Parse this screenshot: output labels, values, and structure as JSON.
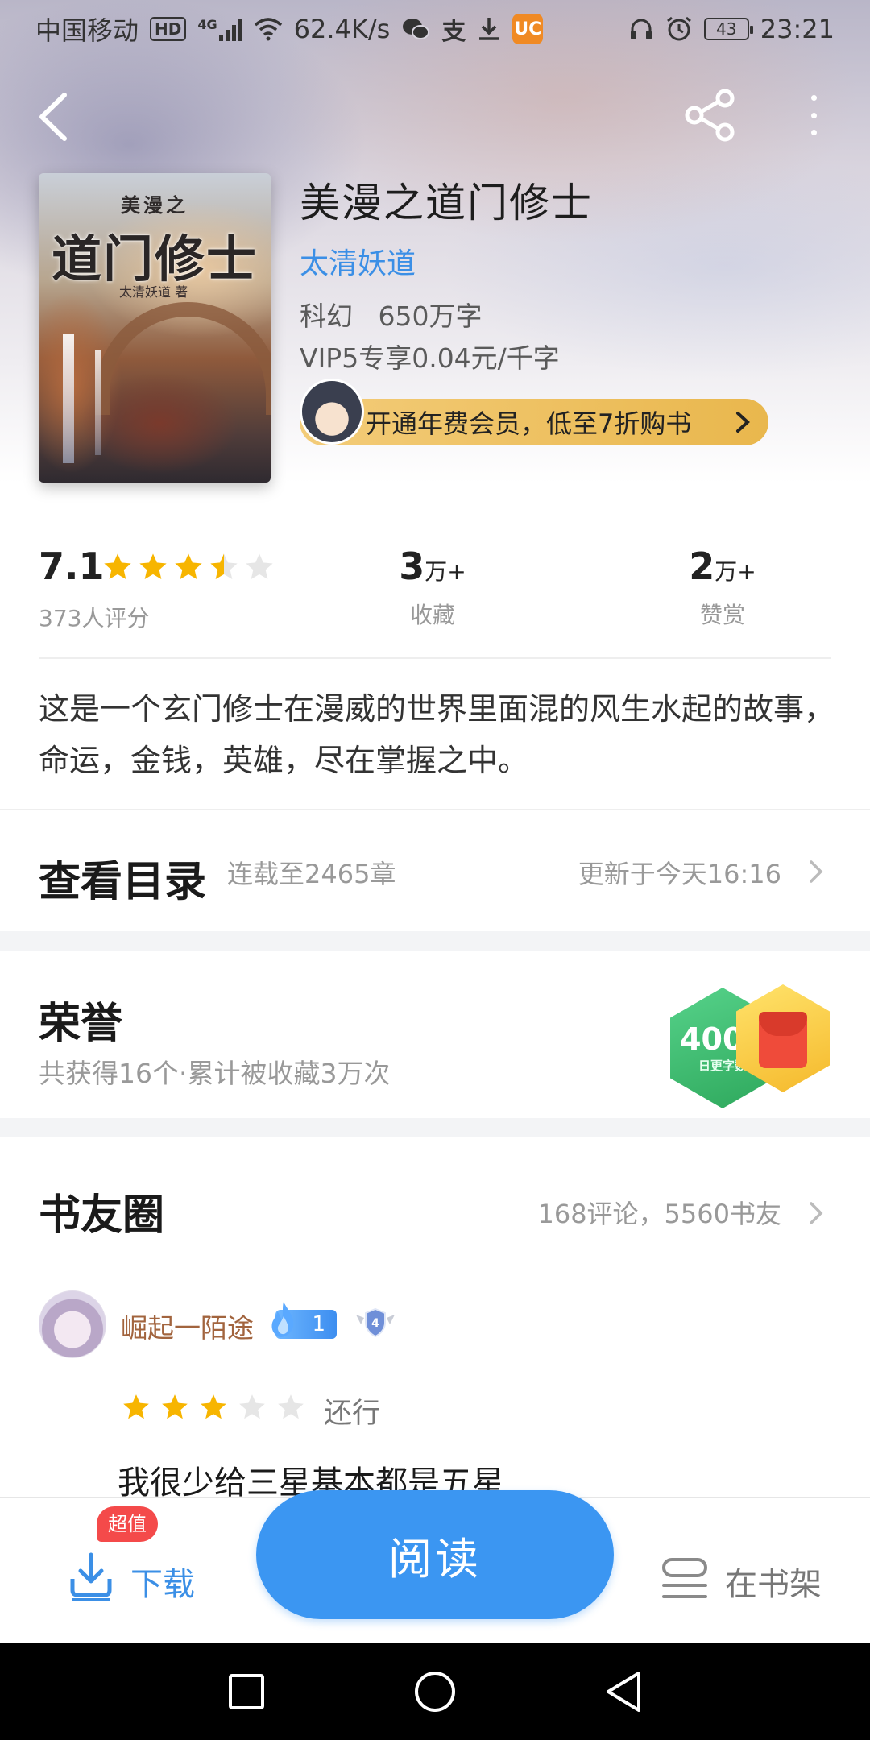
{
  "status_bar": {
    "carrier": "中国移动",
    "hd": "HD",
    "network": "4G",
    "speed": "62.4K/s",
    "battery": "43",
    "time": "23:21"
  },
  "book": {
    "cover_top": "美漫之",
    "cover_title": "道门修士",
    "cover_author": "太清妖道 著",
    "title": "美漫之道门修士",
    "author": "太清妖道",
    "meta": "科幻   650万字",
    "price": "VIP5专享0.04元/千字",
    "vip_banner": "开通年费会员，低至7折购书"
  },
  "stats": {
    "rating": "7.1",
    "rating_count": "373人评分",
    "stars": 3.5,
    "favorites_num": "3",
    "favorites_unit": "万+",
    "favorites_label": "收藏",
    "tips_num": "2",
    "tips_unit": "万+",
    "tips_label": "赞赏"
  },
  "intro": "这是一个玄门修士在漫威的世界里面混的风生水起的故事，命运，金钱，英雄，尽在掌握之中。",
  "catalog": {
    "title": "查看目录",
    "status": "连载至2465章",
    "updated": "更新于今天16:16"
  },
  "honor": {
    "title": "荣誉",
    "summary": "共获得16个·累计被收藏3万次",
    "badge_number": "4000",
    "badge_caption": "日更字数"
  },
  "circle": {
    "title": "书友圈",
    "summary": "168评论，5560书友",
    "comment": {
      "user": "崛起一陌途",
      "level": "1",
      "shield_level": "4",
      "stars": 3,
      "rating_label": "还行",
      "text": "我很少给三星基本都是五星"
    }
  },
  "bottom_bar": {
    "download": "下载",
    "deal": "超值",
    "read": "阅读",
    "shelf": "在书架"
  },
  "colors": {
    "accent": "#3b96f2",
    "author_link": "#3b8fe6",
    "star": "#f7b500",
    "vip_gold": "#e9b74d"
  }
}
